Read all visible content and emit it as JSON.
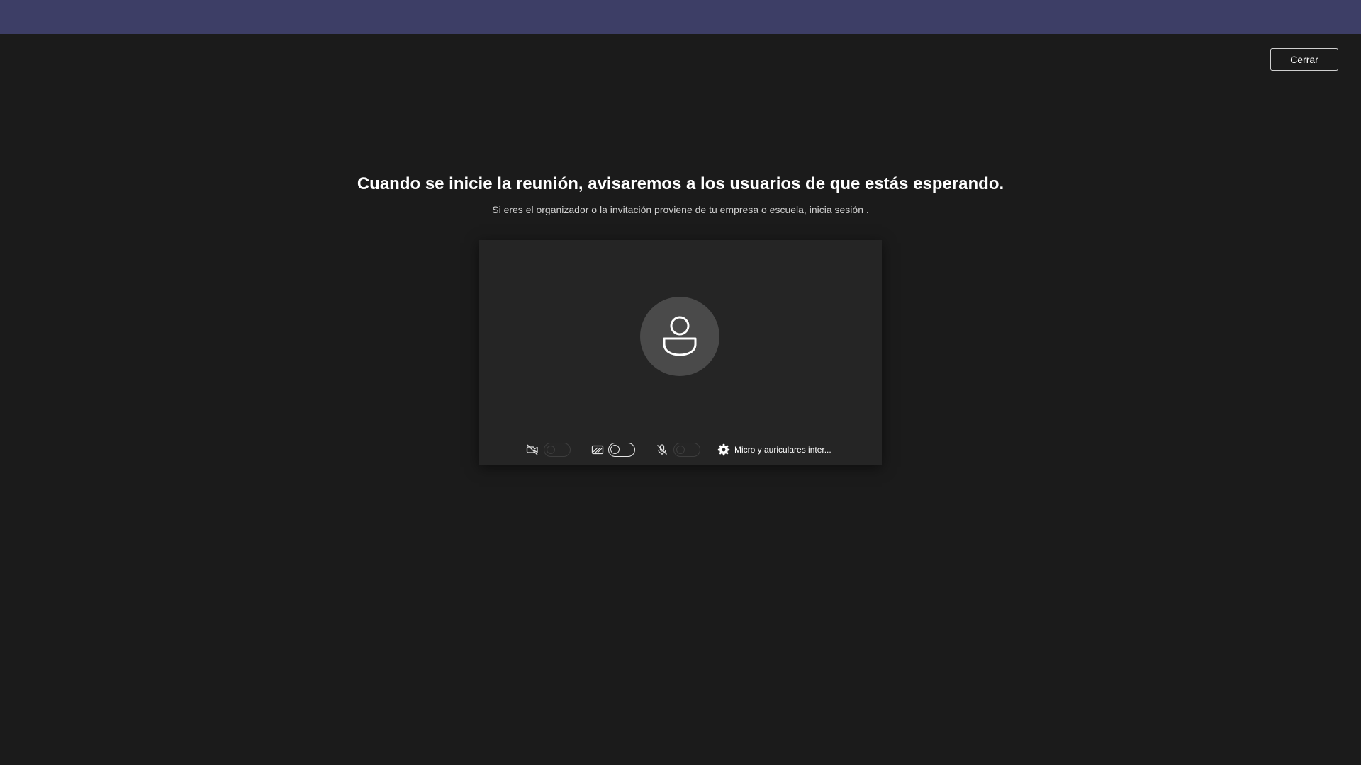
{
  "header": {
    "close_label": "Cerrar"
  },
  "main": {
    "headline": "Cuando se inicie la reunión, avisaremos a los usuarios de que estás esperando.",
    "subline": "Si eres el organizador o la invitación proviene de tu empresa o escuela, inicia sesión ."
  },
  "preview": {
    "avatar_icon": "person-icon",
    "camera": {
      "icon": "camera-off-icon",
      "on": false,
      "enabled": false
    },
    "background_effects": {
      "icon": "background-blur-icon",
      "on": false,
      "enabled": true
    },
    "microphone": {
      "icon": "mic-off-icon",
      "on": false,
      "enabled": false
    },
    "device_settings": {
      "icon": "gear-icon",
      "label": "Micro y auriculares inter..."
    }
  },
  "colors": {
    "topbar": "#3d3e66",
    "background": "#1b1b1b",
    "panel": "#252525",
    "avatar": "#4a4a4a"
  }
}
